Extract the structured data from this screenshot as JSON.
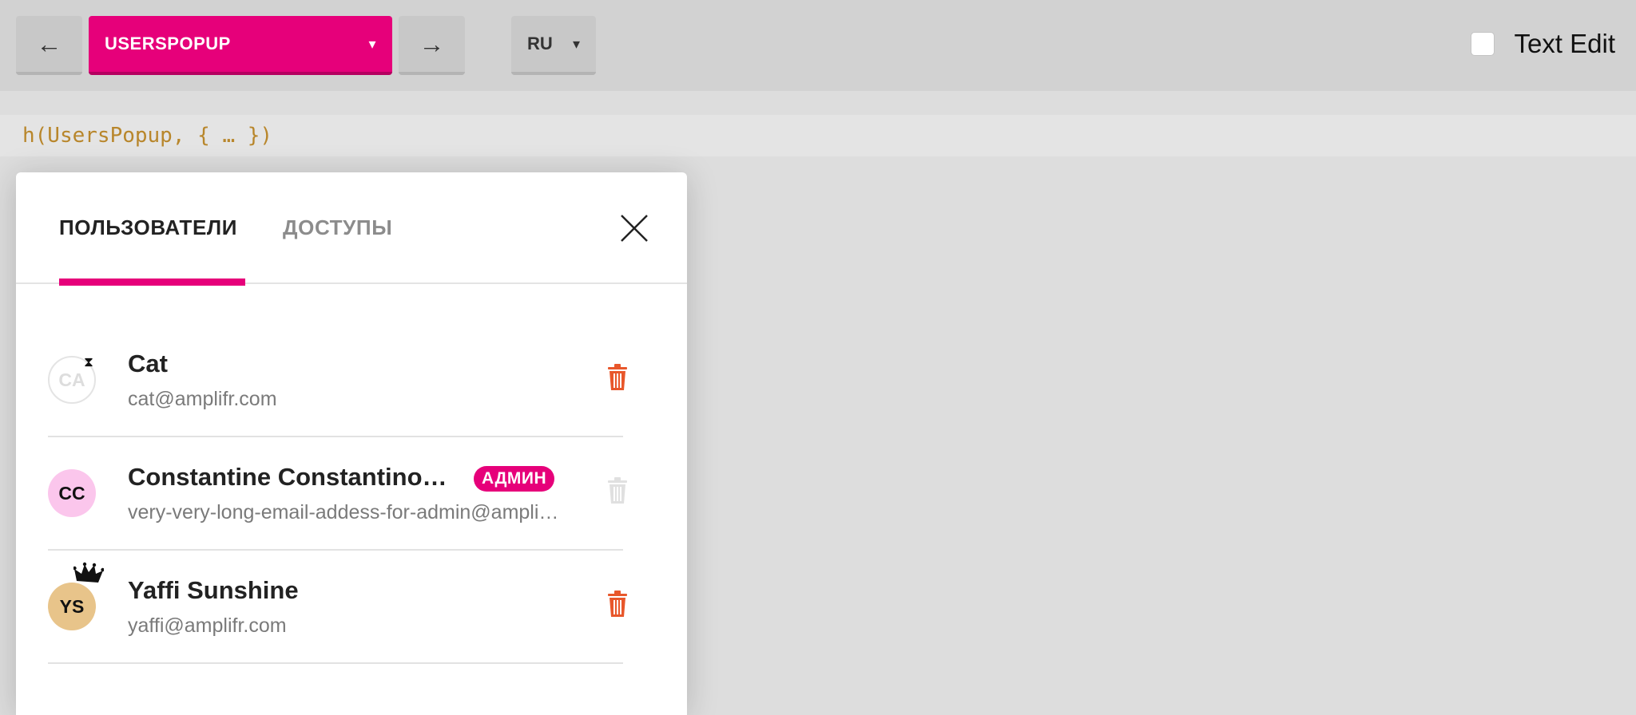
{
  "toolbar": {
    "prev_label": "←",
    "next_label": "→",
    "story_label": "USERSPOPUP",
    "story_caret": "▾",
    "lang_label": "RU",
    "lang_caret": "▾",
    "text_edit_label": "Text Edit"
  },
  "code_line": "h(UsersPopup, { … })",
  "popup": {
    "tabs": [
      {
        "label": "ПОЛЬЗОВАТЕЛИ",
        "active": true
      },
      {
        "label": "ДОСТУПЫ",
        "active": false
      }
    ],
    "users": [
      {
        "initials": "CA",
        "name": "Cat",
        "email": "cat@amplifr.com",
        "status_icon": "hourglass-icon",
        "status_glyph": "⧗",
        "badge": "",
        "deletable": true
      },
      {
        "initials": "CC",
        "name": "Constantine Constantinopolsky",
        "email": "very-very-long-email-addess-for-admin@amplifr.com",
        "status_icon": "",
        "badge": "АДМИН",
        "deletable": false
      },
      {
        "initials": "YS",
        "name": "Yaffi Sunshine",
        "email": "yaffi@amplifr.com",
        "status_icon": "crown-icon",
        "badge": "",
        "deletable": true
      }
    ]
  },
  "colors": {
    "accent": "#e6007a",
    "trash_active": "#e8572b",
    "trash_disabled": "#e0e0e0",
    "code_text": "#b8862b",
    "avatar_admin": "#fbc6ec",
    "avatar_owner": "#e8c48a"
  }
}
